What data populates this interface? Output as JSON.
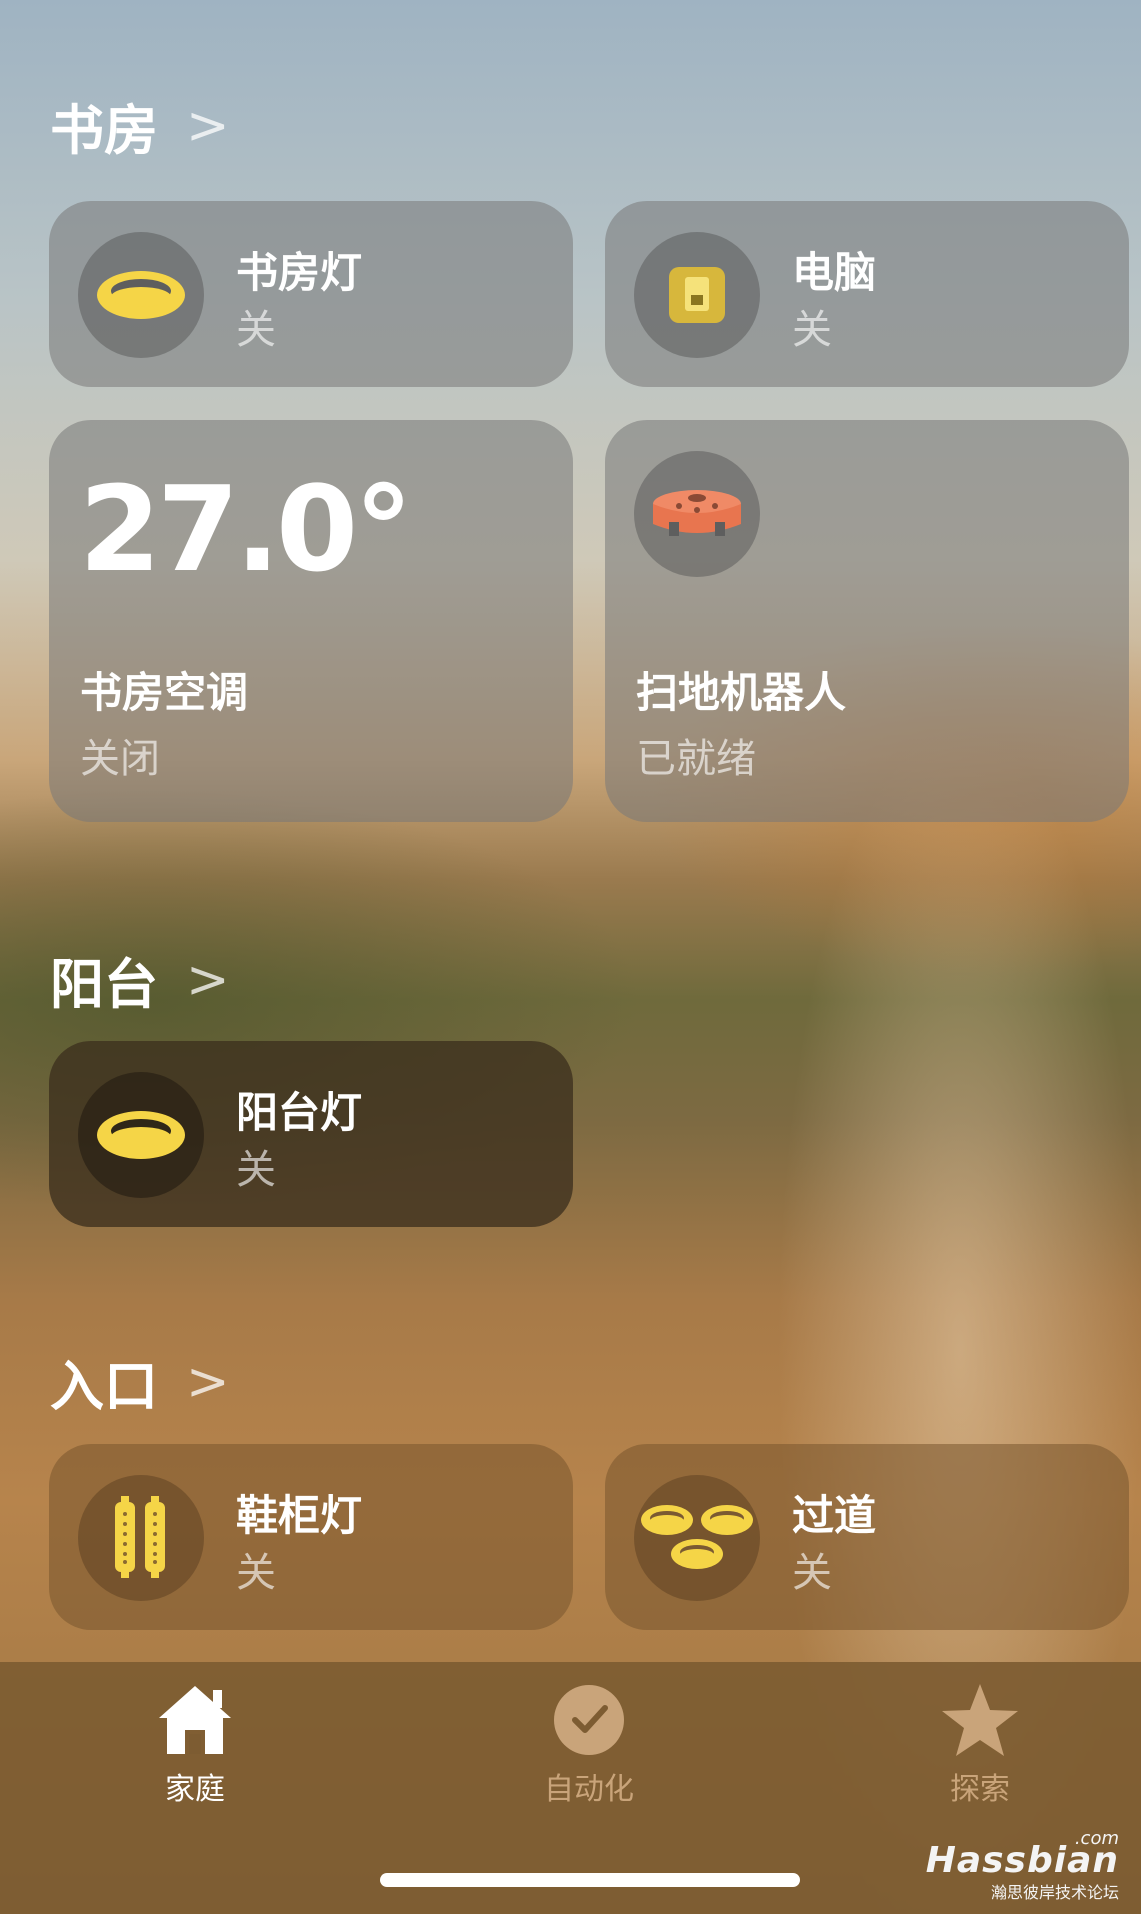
{
  "sections": [
    {
      "title": "书房",
      "tiles": [
        {
          "name": "书房灯",
          "status": "关",
          "icon": "ceiling-light-icon"
        },
        {
          "name": "电脑",
          "status": "关",
          "icon": "outlet-switch-icon"
        },
        {
          "name": "书房空调",
          "status": "关闭",
          "value": "27.0°",
          "icon": "thermostat"
        },
        {
          "name": "扫地机器人",
          "status": "已就绪",
          "icon": "robot-vacuum-icon"
        }
      ]
    },
    {
      "title": "阳台",
      "tiles": [
        {
          "name": "阳台灯",
          "status": "关",
          "icon": "ceiling-light-icon"
        }
      ]
    },
    {
      "title": "入口",
      "tiles": [
        {
          "name": "鞋柜灯",
          "status": "关",
          "icon": "strip-light-icon"
        },
        {
          "name": "过道",
          "status": "关",
          "icon": "light-group-icon"
        }
      ]
    }
  ],
  "chevron": ">",
  "tabbar": {
    "tabs": [
      {
        "label": "家庭",
        "icon": "house-icon",
        "selected": true
      },
      {
        "label": "自动化",
        "icon": "clock-check-icon",
        "selected": false
      },
      {
        "label": "探索",
        "icon": "star-icon",
        "selected": false
      }
    ]
  },
  "watermark": {
    "brand": "Hassbian",
    "suffix": ".com",
    "subtitle": "瀚思彼岸技术论坛"
  },
  "colors": {
    "light_icon": "#f5d547",
    "vacuum_icon": "#e8754f",
    "tab_selected": "#ffffff",
    "tab_unselected": "#c9a47a"
  }
}
